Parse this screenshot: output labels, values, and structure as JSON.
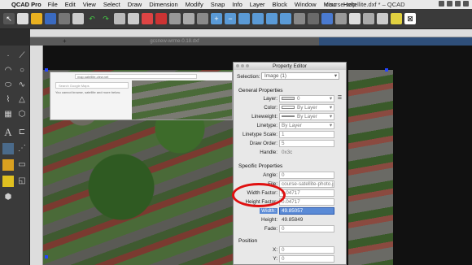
{
  "menubar": {
    "app": "QCAD Pro",
    "items": [
      "File",
      "Edit",
      "View",
      "Select",
      "Draw",
      "Dimension",
      "Modify",
      "Snap",
      "Info",
      "Layer",
      "Block",
      "Window",
      "Misc",
      "Help"
    ],
    "doc_title": "course-satellite.dxf * – QCAD"
  },
  "tabs": {
    "inactive": "gcsnew-wrme-0.18.dxf"
  },
  "browser": {
    "address": "map.satellite-view.net",
    "search_placeholder": "Search Google Maps",
    "hint": "You cannot browse, satellite and more below."
  },
  "property_editor": {
    "title": "Property Editor",
    "selection_label": "Selection:",
    "selection_value": "Image (1)",
    "general_header": "General Properties",
    "layer_label": "Layer:",
    "layer_value": "0",
    "color_label": "Color:",
    "color_value": "By Layer",
    "lineweight_label": "Lineweight:",
    "lineweight_value": "By Layer",
    "linetype_label": "Linetype:",
    "linetype_value": "By Layer",
    "linetype_scale_label": "Linetype Scale:",
    "linetype_scale_value": "1",
    "draw_order_label": "Draw Order:",
    "draw_order_value": "5",
    "handle_label": "Handle:",
    "handle_value": "0x3c",
    "specific_header": "Specific Properties",
    "angle_label": "Angle:",
    "angle_value": "0",
    "file_label": "File:",
    "file_value": "course-satellite-photo.jpg",
    "width_factor_label": "Width Factor:",
    "width_factor_value": "0.04717",
    "height_factor_label": "Height Factor:",
    "height_factor_value": "0.04717",
    "width_label": "Width:",
    "width_value": "49.85057",
    "height_label": "Height:",
    "height_value": "49.85849",
    "fade_label": "Fade:",
    "fade_value": "0",
    "position_header": "Position",
    "x_label": "X:",
    "x_value": "0",
    "y_label": "Y:",
    "y_value": "0"
  },
  "colors": {
    "highlight": "#5a8ad6",
    "annotation": "#e01010",
    "canvas": "#111111"
  }
}
